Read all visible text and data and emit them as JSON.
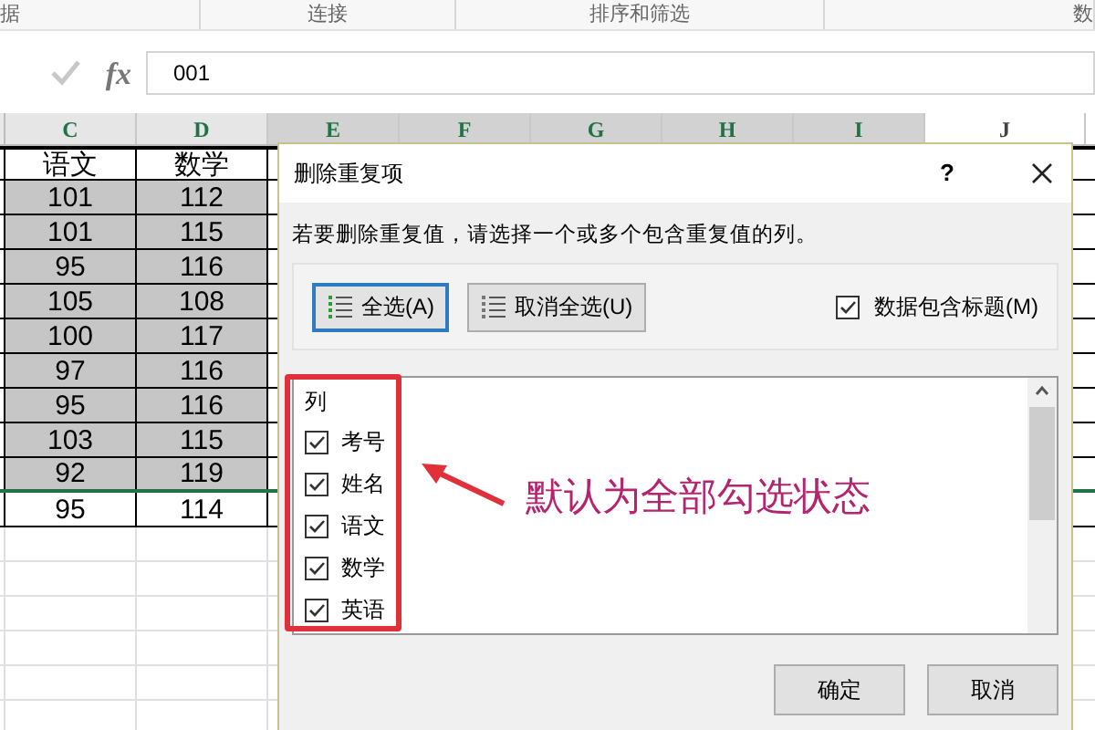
{
  "ribbon_groups": [
    {
      "label": "据"
    },
    {
      "label": "连接"
    },
    {
      "label": "排序和筛选"
    },
    {
      "label": "数"
    }
  ],
  "formula_bar": {
    "function_label": "fx",
    "value": "001"
  },
  "sheet": {
    "columns": [
      {
        "label": "C",
        "selected": false
      },
      {
        "label": "D",
        "selected": false
      },
      {
        "label": "E",
        "selected": true
      },
      {
        "label": "F",
        "selected": true
      },
      {
        "label": "G",
        "selected": true
      },
      {
        "label": "H",
        "selected": true
      },
      {
        "label": "I",
        "selected": true
      },
      {
        "label": "J",
        "selected": false
      }
    ],
    "rows": [
      {
        "cells": [
          "语文",
          "数学"
        ],
        "selected": false
      },
      {
        "cells": [
          "101",
          "112"
        ],
        "selected": true
      },
      {
        "cells": [
          "101",
          "115"
        ],
        "selected": true
      },
      {
        "cells": [
          "95",
          "116"
        ],
        "selected": true
      },
      {
        "cells": [
          "105",
          "108"
        ],
        "selected": true
      },
      {
        "cells": [
          "100",
          "117"
        ],
        "selected": true
      },
      {
        "cells": [
          "97",
          "116"
        ],
        "selected": true
      },
      {
        "cells": [
          "95",
          "116"
        ],
        "selected": true
      },
      {
        "cells": [
          "103",
          "115"
        ],
        "selected": true
      },
      {
        "cells": [
          "92",
          "119"
        ],
        "selected": true
      },
      {
        "cells": [
          "95",
          "114"
        ],
        "selected": false
      }
    ]
  },
  "dialog": {
    "title": "删除重复项",
    "help": "?",
    "instruction": "若要删除重复值，请选择一个或多个包含重复值的列。",
    "select_all": "全选(A)",
    "unselect_all": "取消全选(U)",
    "header_option": {
      "label": "数据包含标题(M)",
      "checked": true
    },
    "list_header": "列",
    "columns": [
      {
        "label": "考号",
        "checked": true
      },
      {
        "label": "姓名",
        "checked": true
      },
      {
        "label": "语文",
        "checked": true
      },
      {
        "label": "数学",
        "checked": true
      },
      {
        "label": "英语",
        "checked": true
      }
    ],
    "buttons": [
      "确定",
      "取消"
    ]
  },
  "annotation": {
    "text": "默认为全部勾选状态"
  }
}
